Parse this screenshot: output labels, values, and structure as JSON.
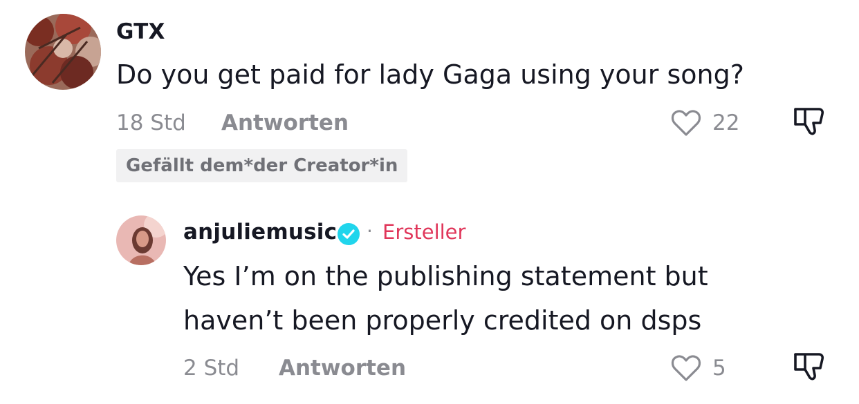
{
  "comments": [
    {
      "username": "GTX",
      "text": "Do you get paid for lady Gaga using your song?",
      "time": "18 Std",
      "reply_label": "Antworten",
      "likes": "22",
      "creator_liked_label": "Gefällt dem*der Creator*in"
    }
  ],
  "reply": {
    "username": "anjuliemusic",
    "verified": true,
    "creator_label": "Ersteller",
    "text": "Yes I’m on the publishing statement but haven’t been properly credited on dsps",
    "time": "2 Std",
    "reply_label": "Antworten",
    "likes": "5"
  },
  "colors": {
    "text_primary": "#161823",
    "text_secondary": "#8a8b91",
    "creator_accent": "#e0365a",
    "verified_blue": "#20d5ec",
    "badge_bg": "#f1f1f2"
  },
  "icons": {
    "like": "heart-outline-icon",
    "dislike": "thumbs-down-icon",
    "verified": "verified-check-icon"
  }
}
